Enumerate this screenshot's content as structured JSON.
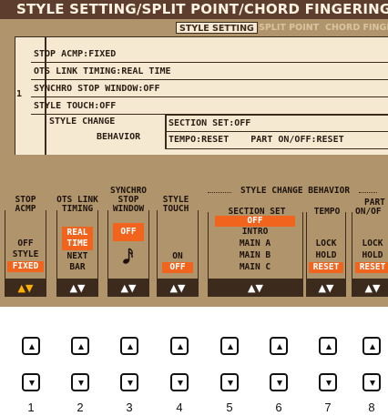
{
  "screen": {
    "title": "STYLE SETTING/SPLIT POINT/CHORD FINGERING",
    "tabs": [
      {
        "label": "STYLE SETTING",
        "active": true
      },
      {
        "label": "SPLIT POINT",
        "active": false
      },
      {
        "label": "CHORD FINGERING",
        "active": false
      }
    ]
  },
  "settings": {
    "index": "1",
    "stop_acmp": "STOP ACMP:FIXED",
    "ots_link": "OTS LINK TIMING:REAL TIME",
    "synchro_stop": "SYNCHRO STOP WINDOW:OFF",
    "style_touch": "STYLE TOUCH:OFF",
    "change_behavior_label_1": "STYLE CHANGE",
    "change_behavior_label_2": "BEHAVIOR",
    "section_set": "SECTION SET:OFF",
    "tempo": "TEMPO:RESET",
    "part_onoff": "PART ON/OFF:RESET"
  },
  "columns": {
    "stop_acmp": {
      "h1": "STOP",
      "h2": "ACMP",
      "options": [
        "OFF",
        "STYLE",
        "FIXED"
      ],
      "selected": "FIXED"
    },
    "ots_link": {
      "h1": "OTS LINK",
      "h2": "TIMING",
      "options": [
        "REAL",
        "TIME",
        "NEXT",
        "BAR"
      ],
      "selected": "REAL TIME"
    },
    "synchro_stop": {
      "h0": "SYNCHRO",
      "h1": "STOP",
      "h2": "WINDOW",
      "options": [
        "OFF"
      ],
      "selected": "OFF",
      "note_icon": "sixteenth-note-icon"
    },
    "style_touch": {
      "h1": "STYLE",
      "h2": "TOUCH",
      "options": [
        "ON",
        "OFF"
      ],
      "selected": "OFF"
    },
    "group_label": "STYLE CHANGE BEHAVIOR",
    "section_set": {
      "h1": "SECTION SET",
      "options": [
        "OFF",
        "INTRO",
        "MAIN A",
        "MAIN B",
        "MAIN C"
      ],
      "selected": "OFF"
    },
    "tempo": {
      "h1": "TEMPO",
      "options": [
        "LOCK",
        "HOLD",
        "RESET"
      ],
      "selected": "RESET"
    },
    "part_onoff": {
      "h1": "PART",
      "h2": "ON/OF",
      "options": [
        "LOCK",
        "HOLD",
        "RESET"
      ],
      "selected": "RESET"
    }
  },
  "lcd_arrows": "▲▼",
  "hardware": {
    "numbers": [
      "1",
      "2",
      "3",
      "4",
      "5",
      "6",
      "7",
      "8"
    ],
    "up_icon": "triangle-up-icon",
    "down_icon": "triangle-down-icon"
  },
  "colors": {
    "lcd_bg": "#b0956c",
    "title_bg": "#5c3d2e",
    "panel_bg": "#f6e9d1",
    "highlight": "#f0641e",
    "dark": "#3c2a1d"
  }
}
